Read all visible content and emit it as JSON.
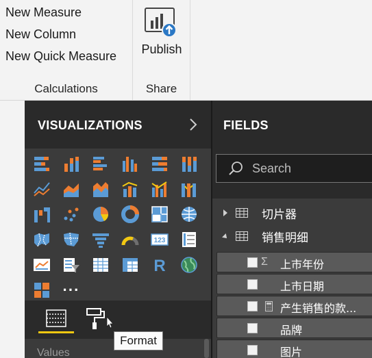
{
  "ribbon": {
    "calculations": {
      "items": [
        "New Measure",
        "New Column",
        "New Quick Measure"
      ],
      "label": "Calculations"
    },
    "share": {
      "publish_label": "Publish",
      "label": "Share",
      "icon": "publish-icon"
    }
  },
  "visualizations": {
    "title": "VISUALIZATIONS",
    "more_label": "···",
    "tooltip": "Format",
    "values_label": "Values",
    "icons": [
      "stacked-bar-chart-icon",
      "stacked-column-chart-icon",
      "clustered-bar-chart-icon",
      "clustered-column-chart-icon",
      "100pct-stacked-bar-chart-icon",
      "100pct-stacked-column-chart-icon",
      "line-chart-icon",
      "area-chart-icon",
      "stacked-area-chart-icon",
      "line-and-stacked-column-icon",
      "line-and-clustered-column-icon",
      "ribbon-chart-icon",
      "waterfall-chart-icon",
      "scatter-chart-icon",
      "pie-chart-icon",
      "donut-chart-icon",
      "treemap-icon",
      "map-icon",
      "filled-map-icon",
      "shape-map-icon",
      "funnel-icon",
      "gauge-icon",
      "card-icon",
      "multi-row-card-icon",
      "kpi-icon",
      "slicer-icon",
      "table-icon",
      "matrix-icon",
      "r-script-visual-icon",
      "globe-map-icon",
      "custom-visual-icon",
      "more-visuals-icon"
    ]
  },
  "fields": {
    "title": "FIELDS",
    "search_placeholder": "Search",
    "tables": [
      {
        "name": "切片器",
        "expanded": false
      },
      {
        "name": "销售明细",
        "expanded": true
      }
    ],
    "items": [
      {
        "type": "Σ",
        "name": "上市年份"
      },
      {
        "type": "",
        "name": "上市日期"
      },
      {
        "type": "calc",
        "name": "产生销售的款..."
      },
      {
        "type": "",
        "name": "品牌"
      },
      {
        "type": "",
        "name": "图片"
      }
    ]
  },
  "colors": {
    "accent_yellow": "#f2c811",
    "pane_dark": "#2a2a2a",
    "pane_mid": "#3b3b3b",
    "field_row": "#5a5a5a",
    "viz_blue": "#5b9bd5",
    "viz_orange": "#ed7d31"
  }
}
